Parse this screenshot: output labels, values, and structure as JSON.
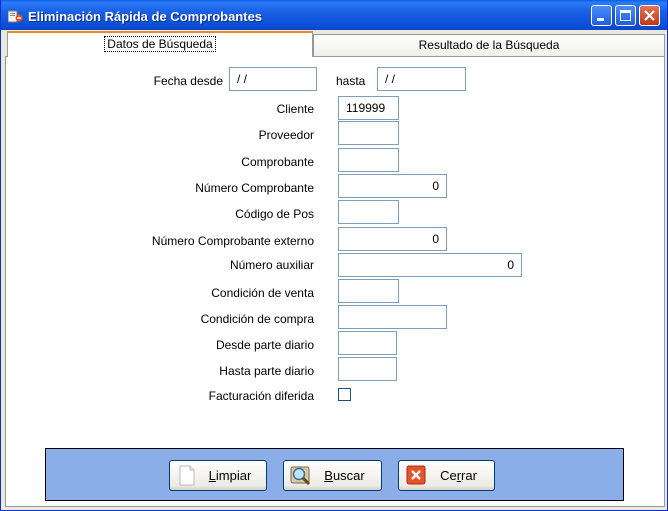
{
  "window": {
    "title": "Eliminación Rápida de Comprobantes"
  },
  "tabs": [
    {
      "label": "Datos de Búsqueda",
      "active": true
    },
    {
      "label": "Resultado de la Búsqueda",
      "active": false
    }
  ],
  "form": {
    "fecha_desde": {
      "label": "Fecha  desde",
      "value": "/ /"
    },
    "hasta": {
      "label": "hasta",
      "value": "/ /"
    },
    "cliente": {
      "label": "Cliente",
      "value": "119999"
    },
    "proveedor": {
      "label": "Proveedor",
      "value": ""
    },
    "comprobante": {
      "label": "Comprobante",
      "value": ""
    },
    "numero_comprobante": {
      "label": "Número Comprobante",
      "value": "0"
    },
    "codigo_pos": {
      "label": "Código de Pos",
      "value": ""
    },
    "numero_comprobante_externo": {
      "label": "Número Comprobante externo",
      "value": "0"
    },
    "numero_auxiliar": {
      "label": "Número auxiliar",
      "value": "0"
    },
    "condicion_venta": {
      "label": "Condición de venta",
      "value": ""
    },
    "condicion_compra": {
      "label": "Condición de compra",
      "value": ""
    },
    "desde_parte_diario": {
      "label": "Desde parte diario",
      "value": ""
    },
    "hasta_parte_diario": {
      "label": "Hasta parte diario",
      "value": ""
    },
    "facturacion_diferida": {
      "label": "Facturación diferida",
      "checked": false
    }
  },
  "buttons": {
    "limpiar": {
      "prefix": "L",
      "rest": "impiar"
    },
    "buscar": {
      "prefix": "B",
      "rest": "uscar"
    },
    "cerrar": {
      "pre": "Ce",
      "key": "r",
      "post": "rar"
    }
  },
  "colors": {
    "titlebar": "#0B4FD6",
    "bottombar": "#8CAEE8",
    "tab_highlight": "#E68B2C"
  }
}
